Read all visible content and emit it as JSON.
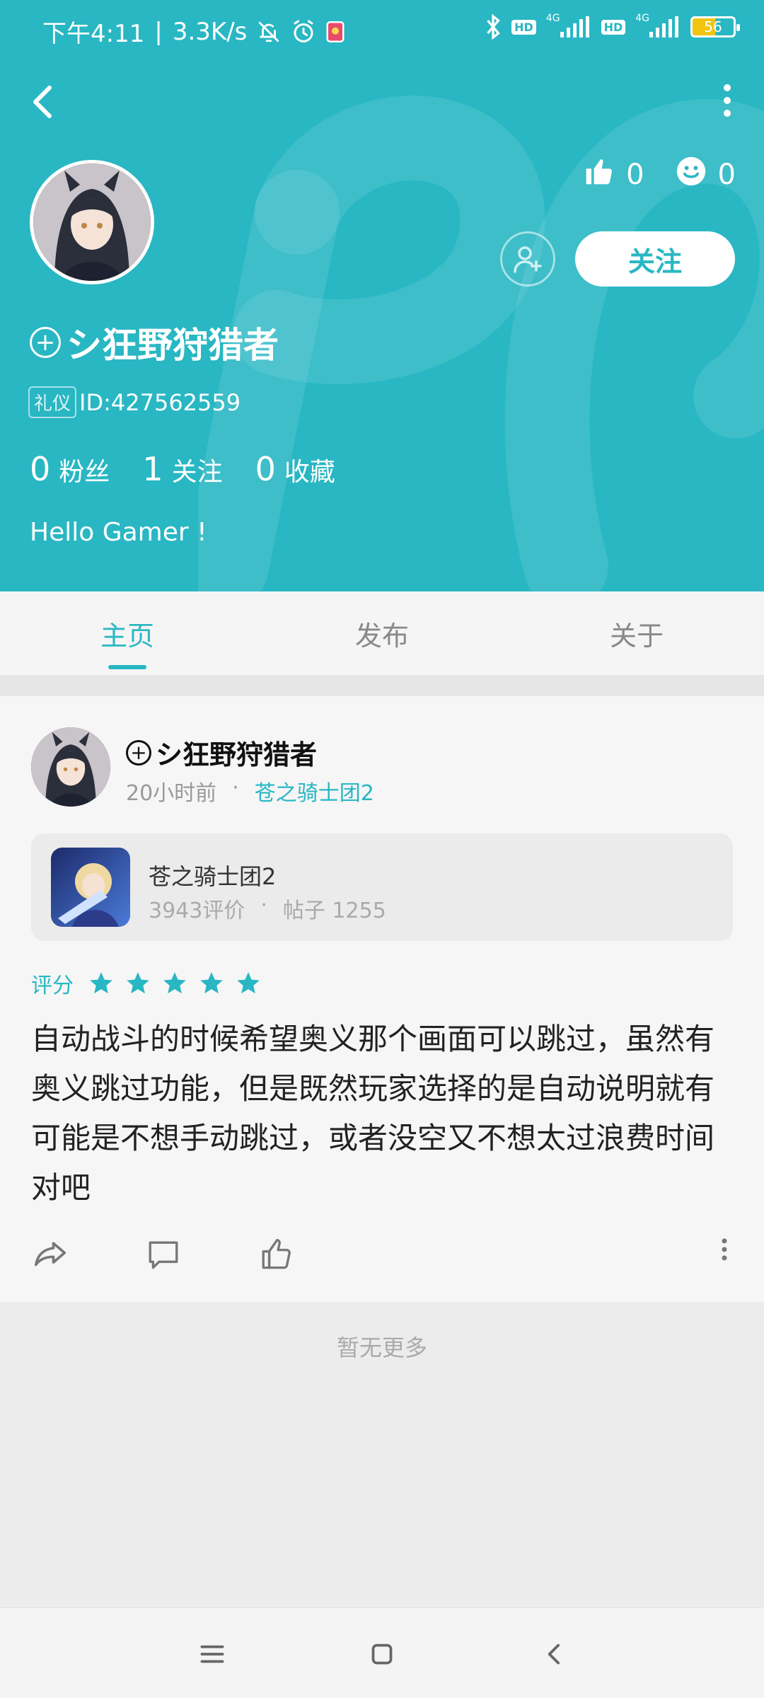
{
  "status_bar": {
    "time": "下午4:11",
    "speed": "3.3K/s",
    "hd1": "HD",
    "net1": "4G",
    "hd2": "HD",
    "net2": "4G",
    "battery": "56"
  },
  "profile": {
    "name": "シ狂野狩猎者",
    "tag": "礼仪",
    "id_text": "ID:427562559",
    "likes": "0",
    "smiles": "0",
    "follow_label": "关注",
    "stats": [
      {
        "value": "0",
        "label": "粉丝"
      },
      {
        "value": "1",
        "label": "关注"
      },
      {
        "value": "0",
        "label": "收藏"
      }
    ],
    "bio": "Hello Gamer !"
  },
  "tabs": [
    {
      "label": "主页",
      "active": true
    },
    {
      "label": "发布",
      "active": false
    },
    {
      "label": "关于",
      "active": false
    }
  ],
  "post": {
    "author": "シ狂野狩猎者",
    "time": "20小时前",
    "dot": "·",
    "game": "苍之骑士团2",
    "game_card": {
      "name": "苍之骑士团2",
      "reviews": "3943评价",
      "dot": "·",
      "posts": "帖子 1255"
    },
    "rating_label": "评分",
    "rating": 5,
    "body": "自动战斗的时候希望奥义那个画面可以跳过，虽然有奥义跳过功能，但是既然玩家选择的是自动说明就有可能是不想手动跳过，或者没空又不想太过浪费时间对吧"
  },
  "footer_text": "暂无更多",
  "colors": {
    "accent": "#28b7c3",
    "star": "#28b7c3"
  }
}
